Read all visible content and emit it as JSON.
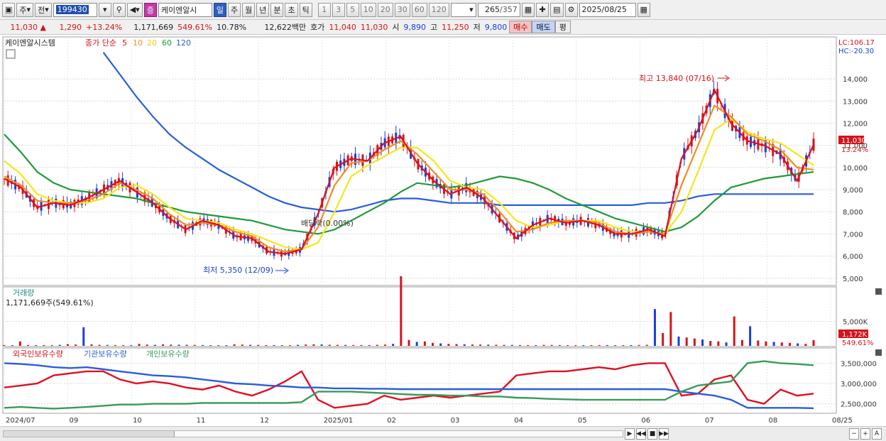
{
  "toolbar": {
    "market_label": "주",
    "prev_label": "전",
    "code": "199430",
    "stock_badge": "증",
    "stock_name": "케이엔알시",
    "periods": [
      "일",
      "주",
      "월",
      "년",
      "분",
      "초",
      "틱"
    ],
    "intervals": [
      "1",
      "3",
      "5",
      "10",
      "20",
      "30",
      "60",
      "120"
    ],
    "count": "265",
    "total": "/357",
    "date": "2025/08/25"
  },
  "quote": {
    "price": "11,030",
    "change": "1,290",
    "change_pct": "+13.24%",
    "volume": "1,171,669",
    "vol_ratio": "549.61%",
    "turnover": "10.78%",
    "amount": "12,622백만",
    "bid_label": "호가",
    "ask": "11,040",
    "bid": "11,030",
    "open_label": "시",
    "open": "9,890",
    "high_label": "고",
    "high": "11,250",
    "low_label": "저",
    "low": "9,800",
    "buy": "매수",
    "sell": "매도",
    "eval": "평"
  },
  "price_panel": {
    "name": "케이엔알시스템",
    "ma_label": "종가 단순",
    "ma_periods": [
      "5",
      "10",
      "20",
      "60",
      "120"
    ],
    "lc": "LC:106.17",
    "hc": "HC:-20.30",
    "high_note": "최고 13,840 (07/16)",
    "low_note": "최저 5,350 (12/09)",
    "dividend_note": "배당락(0.00%)",
    "last_price_tag": "11,030",
    "last_pct_tag": "13.24%"
  },
  "volume_panel": {
    "title": "거래량",
    "value": "1,171,669주(549.61%)",
    "last_tag": "1,172K",
    "pct_tag": "549.61%"
  },
  "holding_panel": {
    "series_names": [
      "외국인보유수량",
      "기관보유수량",
      "개인보유수량"
    ]
  },
  "colors": {
    "up": "#d4141a",
    "down": "#1b3fd6",
    "ma5": "#e0101e",
    "ma10": "#f28c1f",
    "ma20": "#f5e61a",
    "ma60": "#1f9a3a",
    "ma120": "#2a5ed8",
    "foreign": "#e0101e",
    "institution": "#2a5ed8",
    "individual": "#3a9a5a"
  },
  "chart_data": [
    {
      "type": "line",
      "title": "",
      "x": [
        "2024/07",
        "09",
        "10",
        "11",
        "12",
        "2025/01",
        "02",
        "03",
        "04",
        "05",
        "06",
        "07",
        "08",
        "08/25"
      ],
      "ylabel": "",
      "y_ticks": [
        "5,000",
        "6,000",
        "7,000",
        "8,000",
        "9,000",
        "10,000",
        "11,000",
        "12,000",
        "13,000",
        "14,000"
      ],
      "ylim": [
        4800,
        15000
      ],
      "series": [
        {
          "name": "5",
          "role": "ma5",
          "values": [
            9500,
            9100,
            8200,
            8400,
            8300,
            8600,
            9000,
            9400,
            8900,
            8400,
            7700,
            7200,
            7600,
            7400,
            6900,
            6800,
            6200,
            6100,
            6300,
            7900,
            10000,
            10400,
            10300,
            11100,
            11400,
            10200,
            9400,
            8800,
            9100,
            8600,
            7700,
            6800,
            7400,
            7700,
            7500,
            7600,
            7400,
            7000,
            7000,
            7200,
            6900,
            10400,
            11700,
            13500,
            12000,
            11200,
            11000,
            10600,
            9400,
            11030
          ]
        },
        {
          "name": "10",
          "role": "ma10",
          "values": [
            9600,
            9200,
            8500,
            8400,
            8400,
            8500,
            8800,
            9300,
            9000,
            8600,
            7900,
            7400,
            7500,
            7400,
            7100,
            6900,
            6400,
            6200,
            6300,
            7300,
            9200,
            10200,
            10300,
            10800,
            11200,
            10600,
            9800,
            9000,
            9000,
            8800,
            8000,
            7100,
            7200,
            7500,
            7600,
            7600,
            7500,
            7100,
            7000,
            7100,
            7000,
            9200,
            11000,
            12800,
            12300,
            11500,
            11200,
            10800,
            10000,
            9900
          ]
        },
        {
          "name": "20",
          "role": "ma20",
          "values": [
            10300,
            9700,
            8800,
            8500,
            8400,
            8400,
            8600,
            9100,
            9200,
            8800,
            8200,
            7700,
            7600,
            7500,
            7200,
            7000,
            6700,
            6400,
            6300,
            6600,
            8000,
            9600,
            10100,
            10500,
            10900,
            10900,
            10300,
            9400,
            9100,
            9000,
            8400,
            7600,
            7300,
            7400,
            7600,
            7600,
            7600,
            7300,
            7100,
            7100,
            7000,
            8000,
            9800,
            11700,
            12200,
            11600,
            11300,
            11100,
            10600,
            10100
          ]
        },
        {
          "name": "60",
          "role": "ma60",
          "values": [
            11500,
            10700,
            9800,
            9300,
            9000,
            8900,
            8800,
            8700,
            8600,
            8400,
            8200,
            8000,
            7900,
            7800,
            7700,
            7600,
            7400,
            7200,
            7100,
            7000,
            7200,
            7600,
            8000,
            8400,
            8900,
            9300,
            9200,
            9100,
            9200,
            9400,
            9600,
            9500,
            9300,
            9000,
            8600,
            8300,
            8000,
            7700,
            7500,
            7300,
            7100,
            7300,
            7800,
            8500,
            9100,
            9300,
            9500,
            9600,
            9700,
            9800
          ]
        },
        {
          "name": "120",
          "role": "ma120",
          "values": [
            null,
            null,
            null,
            null,
            null,
            null,
            15200,
            14200,
            13200,
            12300,
            11500,
            10900,
            10400,
            9900,
            9500,
            9100,
            8700,
            8400,
            8200,
            8100,
            8000,
            8100,
            8300,
            8500,
            8600,
            8600,
            8500,
            8400,
            8400,
            8400,
            8300,
            8300,
            8300,
            8300,
            8300,
            8300,
            8300,
            8300,
            8300,
            8400,
            8400,
            8500,
            8700,
            8800,
            8800,
            8800,
            8800,
            8800,
            8800,
            8800
          ]
        }
      ]
    },
    {
      "type": "bar",
      "title": "",
      "unit": "K",
      "y_ticks": [
        "5,000K"
      ],
      "ylim": [
        0,
        10000
      ],
      "values": [
        150,
        120,
        900,
        180,
        140,
        160,
        130,
        200,
        350,
        260,
        3800,
        300,
        200,
        180,
        160,
        140,
        120,
        400,
        250,
        200,
        300,
        240,
        220,
        210,
        180,
        160,
        140,
        130,
        120,
        300,
        250,
        200,
        180,
        160,
        150,
        140,
        130,
        200,
        260,
        300,
        280,
        220,
        200,
        180,
        170,
        160,
        150,
        200,
        250,
        400,
        14200,
        1200,
        800,
        900,
        600,
        500,
        400,
        350,
        300,
        280,
        260,
        240,
        220,
        200,
        180,
        170,
        160,
        150,
        200,
        180,
        160,
        140,
        120,
        130,
        150,
        170,
        160,
        140,
        130,
        150,
        170,
        200,
        7500,
        2600,
        6900,
        1900,
        1700,
        1500,
        1300,
        1000,
        900,
        700,
        6000,
        1200,
        4000,
        1100,
        900,
        800,
        700,
        600,
        500,
        400,
        1172
      ]
    },
    {
      "type": "line",
      "title": "",
      "y_ticks": [
        "2,500,000",
        "3,000,000",
        "3,500,000"
      ],
      "ylim": [
        2300000,
        3700000
      ],
      "series": [
        {
          "name": "외국인보유수량",
          "role": "foreign",
          "values": [
            2900000,
            2950000,
            3000000,
            3200000,
            3250000,
            3300000,
            3300000,
            3100000,
            3000000,
            3050000,
            3000000,
            2900000,
            2850000,
            2950000,
            2800000,
            2700000,
            2850000,
            3050000,
            3300000,
            2600000,
            2400000,
            2450000,
            2500000,
            2700000,
            2600000,
            2650000,
            2700000,
            2650000,
            2700000,
            2750000,
            2800000,
            3200000,
            3250000,
            3300000,
            3300000,
            3350000,
            3400000,
            3350000,
            3450000,
            3500000,
            3500000,
            2700000,
            2750000,
            3100000,
            3200000,
            2600000,
            2500000,
            2850000,
            2700000,
            2750000
          ]
        },
        {
          "name": "기관보유수량",
          "role": "institution",
          "values": [
            3500000,
            3480000,
            3450000,
            3400000,
            3380000,
            3400000,
            3350000,
            3300000,
            3250000,
            3200000,
            3180000,
            3150000,
            3100000,
            3050000,
            3000000,
            2980000,
            2950000,
            2930000,
            2900000,
            2900000,
            2880000,
            2880000,
            2870000,
            2870000,
            2860000,
            2860000,
            2860000,
            2860000,
            2860000,
            2860000,
            2860000,
            2860000,
            2860000,
            2860000,
            2860000,
            2860000,
            2860000,
            2860000,
            2860000,
            2860000,
            2860000,
            2800000,
            2750000,
            2700000,
            2600000,
            2400000,
            2400000,
            2400000,
            2400000,
            2390000
          ]
        },
        {
          "name": "개인보유수량",
          "role": "individual",
          "values": [
            2400000,
            2420000,
            2400000,
            2380000,
            2400000,
            2420000,
            2450000,
            2480000,
            2480000,
            2500000,
            2500000,
            2500000,
            2520000,
            2520000,
            2520000,
            2520000,
            2520000,
            2520000,
            2540000,
            2800000,
            2800000,
            2800000,
            2780000,
            2760000,
            2740000,
            2720000,
            2720000,
            2700000,
            2700000,
            2680000,
            2680000,
            2650000,
            2640000,
            2620000,
            2610000,
            2600000,
            2600000,
            2600000,
            2600000,
            2600000,
            2600000,
            2800000,
            2950000,
            3000000,
            3050000,
            3500000,
            3550000,
            3500000,
            3480000,
            3450000
          ]
        }
      ]
    }
  ]
}
